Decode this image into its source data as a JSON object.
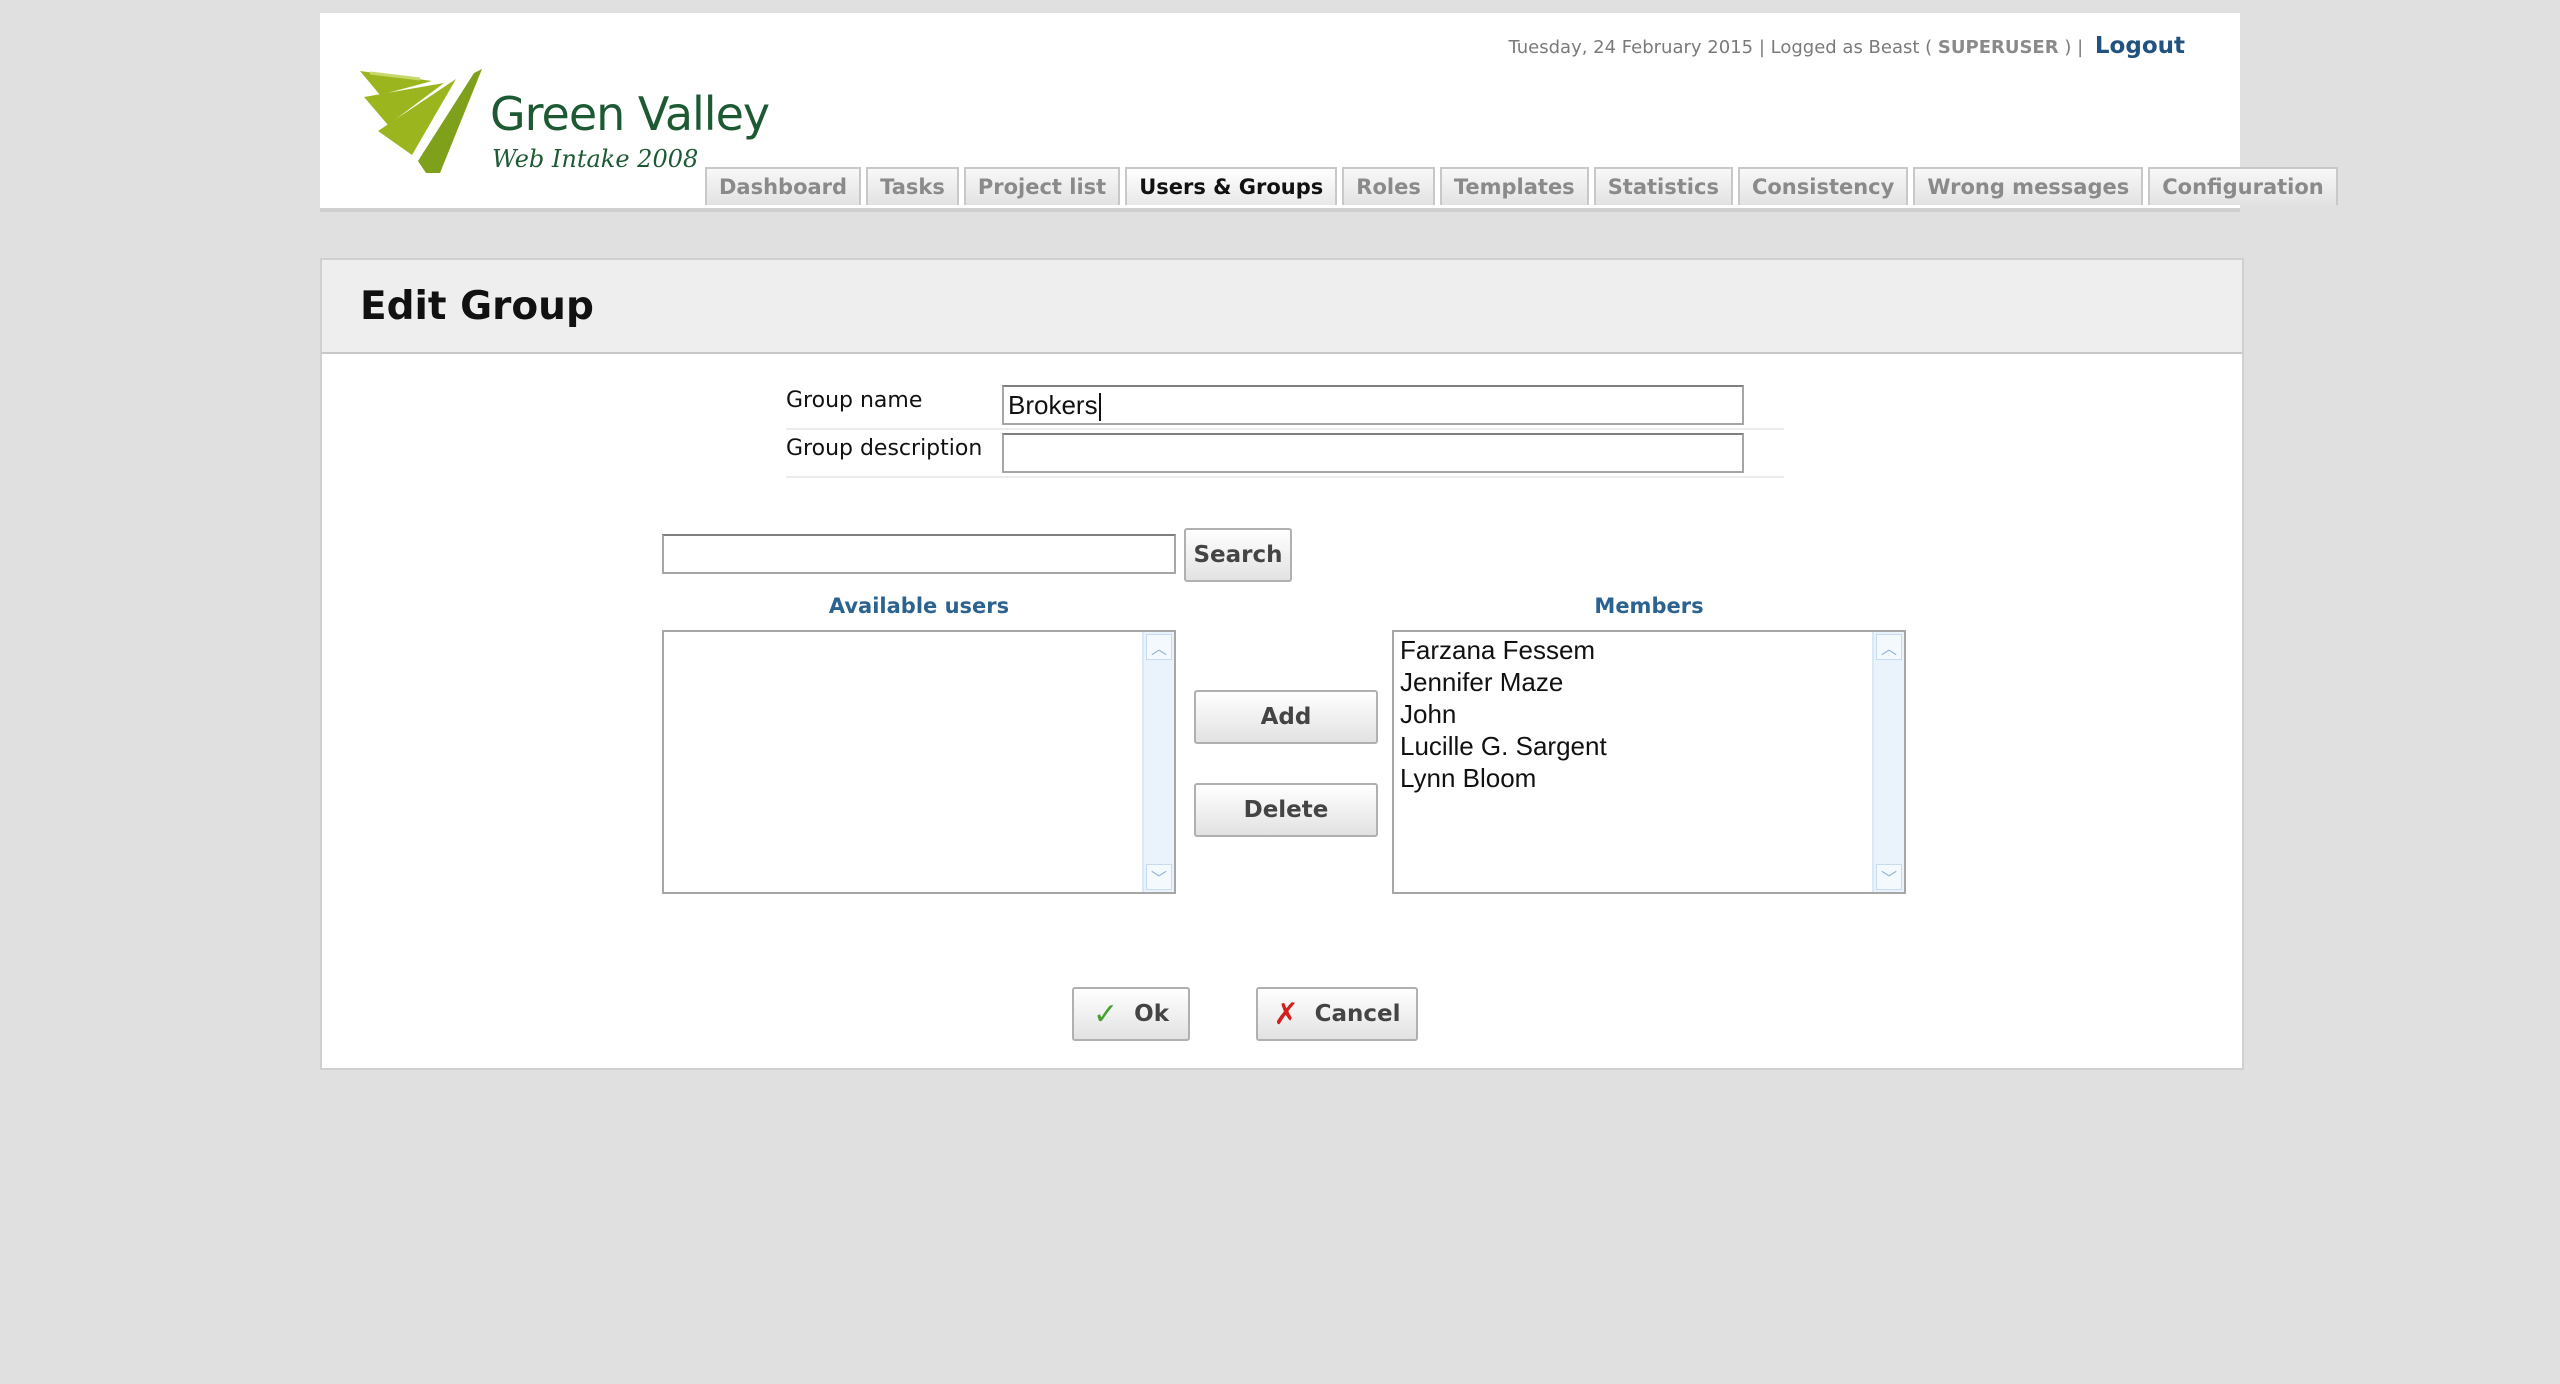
{
  "header": {
    "logo": {
      "title": "Green Valley",
      "subtitle": "Web Intake 2008",
      "colors": {
        "stripes": "#9bb51f",
        "text": "#1d5a34"
      }
    },
    "top_info": {
      "date": "Tuesday, 24 February 2015",
      "separator": "|",
      "logged_as_prefix": "Logged as Beast (",
      "role": "SUPERUSER",
      "logged_as_suffix": ")",
      "logout": "Logout"
    },
    "tabs": [
      {
        "label": "Dashboard",
        "active": false
      },
      {
        "label": "Tasks",
        "active": false
      },
      {
        "label": "Project list",
        "active": false
      },
      {
        "label": "Users & Groups",
        "active": true
      },
      {
        "label": "Roles",
        "active": false
      },
      {
        "label": "Templates",
        "active": false
      },
      {
        "label": "Statistics",
        "active": false
      },
      {
        "label": "Consistency",
        "active": false
      },
      {
        "label": "Wrong messages",
        "active": false
      },
      {
        "label": "Configuration",
        "active": false
      }
    ]
  },
  "panel": {
    "title": "Edit Group",
    "form": {
      "group_name_label": "Group name",
      "group_name_value": "Brokers",
      "group_description_label": "Group description",
      "group_description_value": ""
    },
    "search": {
      "input_value": "",
      "button_label": "Search"
    },
    "available_users": {
      "heading": "Available users",
      "items": []
    },
    "members": {
      "heading": "Members",
      "items": [
        "Farzana Fessem",
        "Jennifer Maze",
        "John",
        "Lucille G. Sargent",
        "Lynn Bloom"
      ]
    },
    "actions": {
      "add_label": "Add",
      "delete_label": "Delete"
    },
    "footer": {
      "ok_label": "Ok",
      "cancel_label": "Cancel"
    }
  },
  "colors": {
    "page_bg": "#e0e0e0",
    "accent_blue": "#2c628f",
    "logout_blue": "#22527f",
    "ok_green": "#46a032",
    "cancel_red": "#d21e1e"
  }
}
